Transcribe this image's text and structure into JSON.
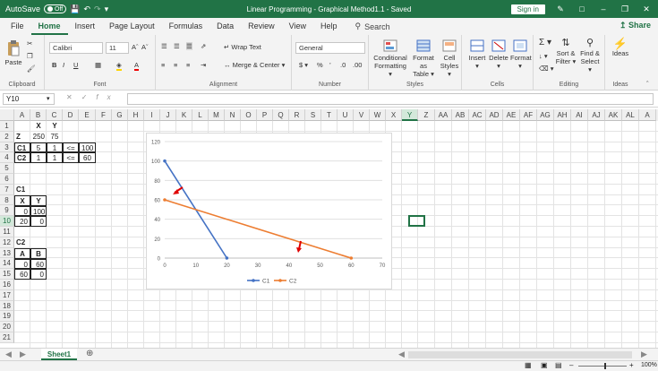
{
  "titlebar": {
    "autosave_label": "AutoSave",
    "autosave_state": "Off",
    "title": "Linear Programming - Graphical Method1.1  -  Saved",
    "signin": "Sign in"
  },
  "menu": {
    "tabs": [
      "File",
      "Home",
      "Insert",
      "Page Layout",
      "Formulas",
      "Data",
      "Review",
      "View",
      "Help"
    ],
    "active": "Home",
    "search": "Search",
    "share": "Share"
  },
  "ribbon": {
    "clipboard": {
      "paste": "Paste",
      "label": "Clipboard"
    },
    "font": {
      "name": "Calibri",
      "size": "11",
      "label": "Font"
    },
    "alignment": {
      "wrap": "Wrap Text",
      "merge": "Merge & Center",
      "label": "Alignment"
    },
    "number": {
      "format": "General",
      "label": "Number"
    },
    "styles": {
      "conditional1": "Conditional",
      "conditional2": "Formatting",
      "format_as1": "Format as",
      "format_as2": "Table",
      "cell_styles1": "Cell",
      "cell_styles2": "Styles",
      "label": "Styles"
    },
    "cells": {
      "insert": "Insert",
      "delete": "Delete",
      "format": "Format",
      "label": "Cells"
    },
    "editing": {
      "sort1": "Sort &",
      "sort2": "Filter",
      "find1": "Find &",
      "find2": "Select",
      "label": "Editing"
    },
    "ideas": {
      "btn": "Ideas",
      "label": "Ideas"
    }
  },
  "formula_bar": {
    "name_box": "Y10",
    "fx": "fx",
    "content": ""
  },
  "columns": [
    "A",
    "B",
    "C",
    "D",
    "E",
    "F",
    "G",
    "H",
    "I",
    "J",
    "K",
    "L",
    "M",
    "N",
    "O",
    "P",
    "Q",
    "R",
    "S",
    "T",
    "U",
    "V",
    "W",
    "X",
    "Y",
    "Z",
    "AA",
    "AB",
    "AC",
    "AD",
    "AE",
    "AF",
    "AG",
    "AH",
    "AI",
    "AJ",
    "AK",
    "AL",
    "A"
  ],
  "rows": [
    "1",
    "2",
    "3",
    "4",
    "5",
    "6",
    "7",
    "8",
    "9",
    "10",
    "11",
    "12",
    "13",
    "14",
    "15",
    "16",
    "17",
    "18",
    "19",
    "20",
    "21"
  ],
  "cells": {
    "b1": "X",
    "c1": "Y",
    "a2": "Z",
    "b2": "250",
    "c2": "75",
    "a3": "C1",
    "b3": "5",
    "c3": "1",
    "d3": "<=",
    "e3": "100",
    "a4": "C2",
    "b4": "1",
    "c4": "1",
    "d4": "<=",
    "e4": "60",
    "a7": "C1",
    "a8": "X",
    "b8": "Y",
    "a9": "0",
    "b9": "100",
    "a10": "20",
    "b10": "0",
    "a13": "C2",
    "a14": "A",
    "b14": "B",
    "a15": "0",
    "b15": "60",
    "a16": "60",
    "b16": "0"
  },
  "chart_data": {
    "type": "line",
    "xlim": [
      0,
      70
    ],
    "ylim": [
      0,
      120
    ],
    "x_ticks": [
      0,
      10,
      20,
      30,
      40,
      50,
      60,
      70
    ],
    "y_ticks": [
      0,
      20,
      40,
      60,
      80,
      100,
      120
    ],
    "series": [
      {
        "name": "C1",
        "color": "#4472c4",
        "x": [
          0,
          20
        ],
        "y": [
          100,
          0
        ]
      },
      {
        "name": "C2",
        "color": "#ed7d31",
        "x": [
          0,
          60
        ],
        "y": [
          60,
          0
        ]
      }
    ],
    "legend": "bottom",
    "grid": "horizontal"
  },
  "sheets": {
    "active": "Sheet1"
  },
  "status": {
    "zoom": "100%"
  }
}
